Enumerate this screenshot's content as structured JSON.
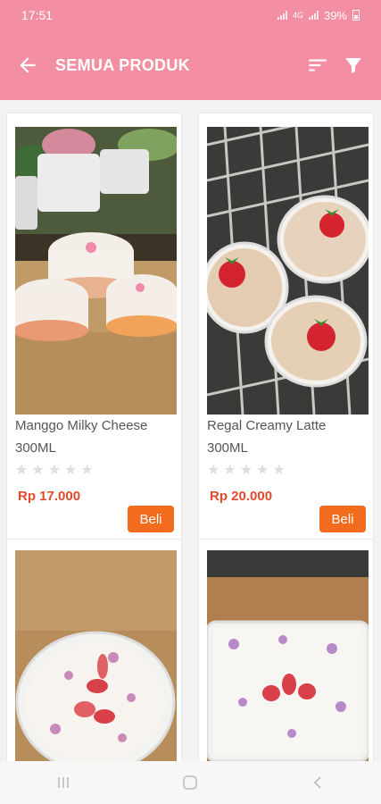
{
  "status": {
    "time": "17:51",
    "battery": "39%"
  },
  "header": {
    "title": "SEMUA PRODUK"
  },
  "products": [
    {
      "name": "Manggo Milky Cheese 300ML",
      "price": "Rp 17.000",
      "rating": 0,
      "buy_label": "Beli"
    },
    {
      "name": "Regal Creamy Latte 300ML",
      "price": "Rp 20.000",
      "rating": 0,
      "buy_label": "Beli"
    },
    {
      "name": "",
      "price": "",
      "rating": 0,
      "buy_label": ""
    },
    {
      "name": "",
      "price": "",
      "rating": 0,
      "buy_label": ""
    }
  ],
  "icons": {
    "back": "arrow-left-icon",
    "sort": "sort-icon",
    "filter": "filter-icon"
  },
  "colors": {
    "primary": "#f48fa3",
    "price": "#e24a2c",
    "button": "#f36b1c"
  }
}
